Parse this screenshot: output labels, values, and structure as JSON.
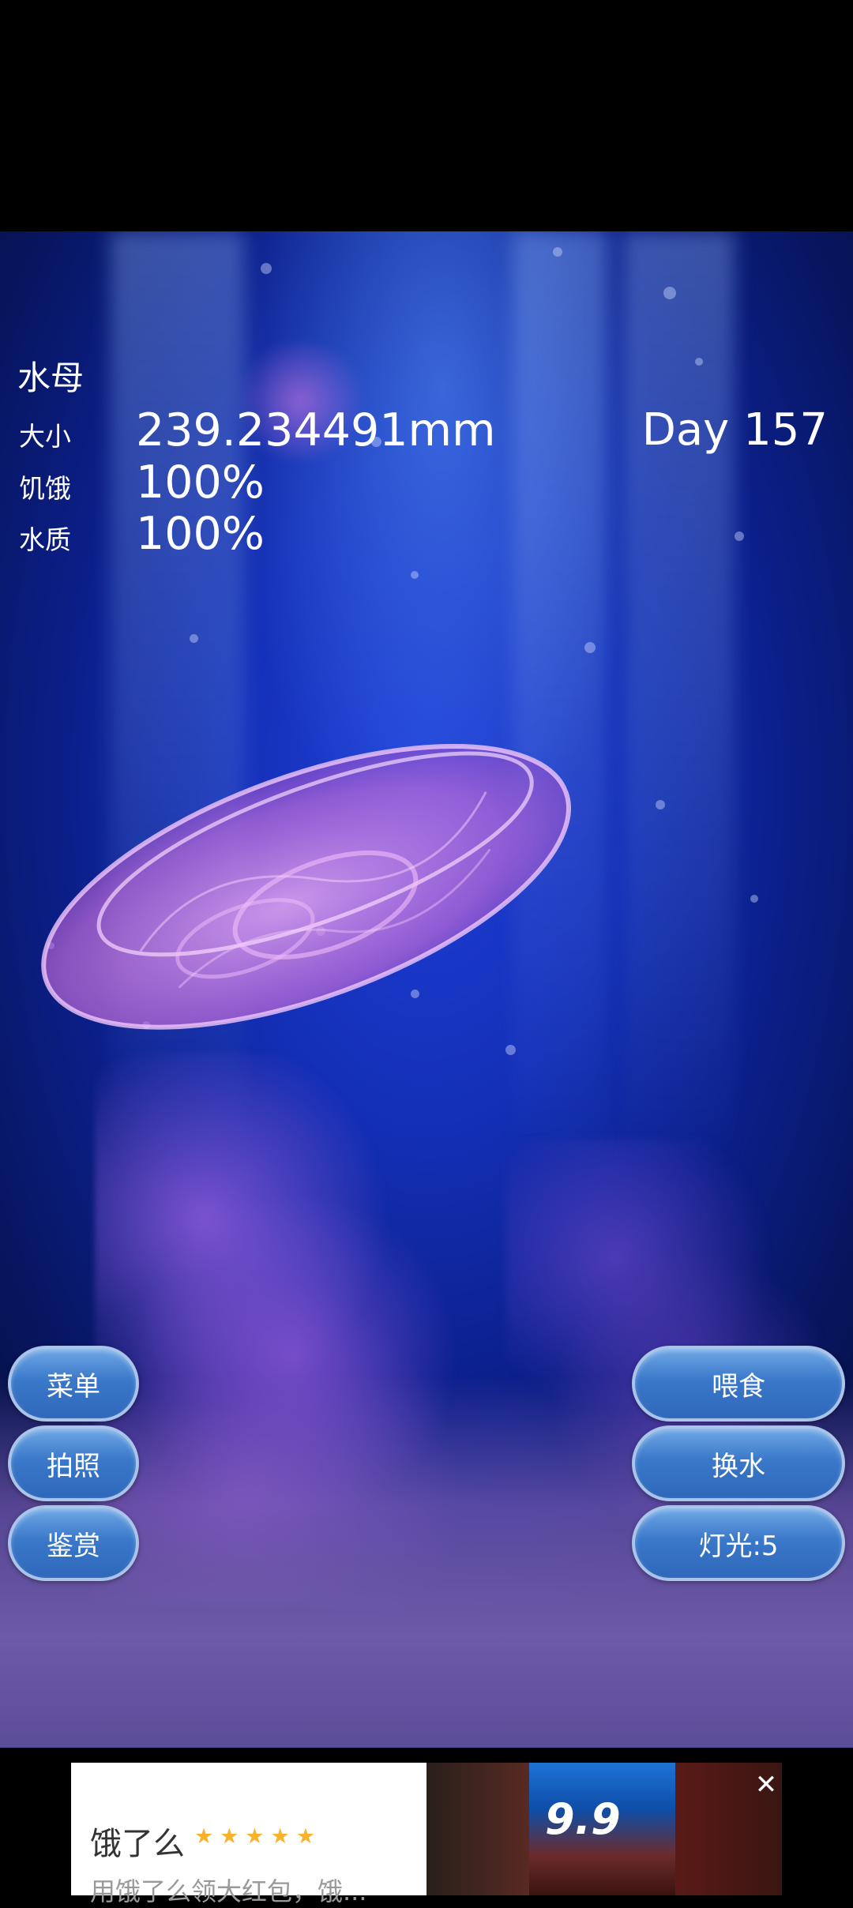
{
  "hud": {
    "title": "水母",
    "size_label": "大小",
    "size_value": "239.234491mm",
    "hunger_label": "饥饿",
    "hunger_value": "100%",
    "water_label": "水质",
    "water_value": "100%",
    "day": "Day 157"
  },
  "buttons": {
    "menu": "菜单",
    "photo": "拍照",
    "gallery": "鉴赏",
    "feed": "喂食",
    "change_water": "换水",
    "light": "灯光:5"
  },
  "ad": {
    "brand": "饿了么",
    "stars": "★★★★★",
    "description": "用饿了么领大红包，饿...",
    "price": "9.9",
    "close_icon": "close-icon"
  },
  "colors": {
    "button_fill": "#3a78c9",
    "button_border": "#a9c4e8",
    "water": "#1430b8",
    "jelly": "#d889e6"
  }
}
